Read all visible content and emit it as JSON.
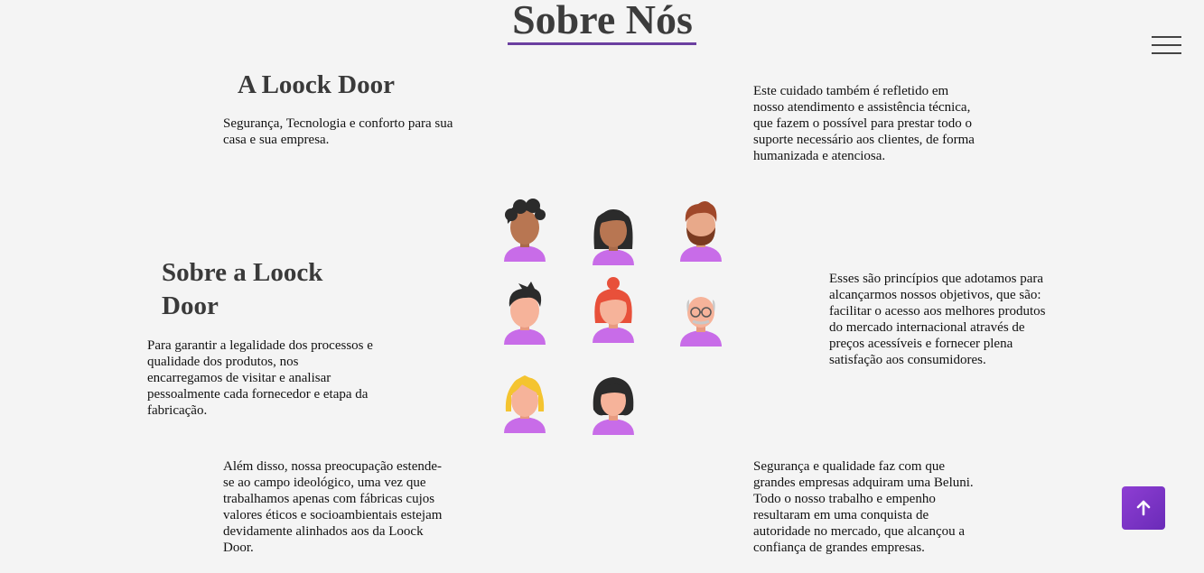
{
  "page": {
    "title": "Sobre Nós"
  },
  "nav": {
    "menu_icon": "hamburger-icon"
  },
  "left": {
    "heading_1": "A Loock Door",
    "text_1": "Segurança, Tecnologia e conforto para sua casa e sua empresa.",
    "heading_2": "Sobre a Loock Door",
    "text_2": "Para garantir a legalidade dos processos e qualidade dos produtos, nos encarregamos de visitar e analisar pessoalmente cada fornecedor e etapa da fabricação.",
    "text_3": "Além disso, nossa preocupação estende-se ao campo ideológico, uma vez que trabalhamos apenas com fábricas cujos valores éticos e socioambientais estejam devidamente alinhados aos da Loock Door."
  },
  "right": {
    "text_1": "Este cuidado também é refletido em nosso atendimento e assistência técnica, que fazem o possível para prestar todo o suporte necessário aos clientes, de forma humanizada e atenciosa.",
    "text_2": "Esses são princípios que adotamos para alcançarmos nossos objetivos, que são: facilitar o acesso aos melhores produtos do mercado internacional através de preços acessíveis e fornecer plena satisfação aos consumidores.",
    "text_3": "Segurança e qualidade faz com que grandes empresas adquiram uma Beluni. Todo o nosso trabalho e empenho resultaram em uma conquista de autoridade no mercado, que alcançou a confiança de grandes empresas."
  },
  "illustration": {
    "name": "people-avatars-illustration",
    "shirt_color": "#c86ce8"
  },
  "scroll_top": {
    "icon": "arrow-up-icon",
    "color": "#7f3bcf"
  },
  "colors": {
    "background": "#f4f4f4",
    "accent": "#6b3fa0",
    "heading": "#3a3a3a"
  }
}
